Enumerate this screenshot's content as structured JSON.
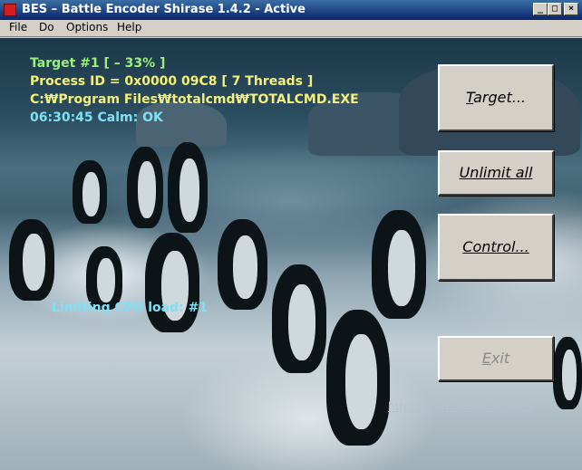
{
  "window": {
    "title": "BES – Battle Encoder Shirase 1.4.2 - Active",
    "controls": {
      "minimize": "_",
      "maximize": "□",
      "close": "×"
    }
  },
  "menu": {
    "file": "File",
    "do": "Do",
    "options": "Options",
    "help": "Help"
  },
  "status": {
    "target": "Target #1 [ – 33% ]",
    "process": "Process ID = 0x0000 09C8 [ 7 Threads ]",
    "path": "C:₩Program Files₩totalcmd₩TOTALCMD.EXE",
    "time": "06:30:45 Calm: OK",
    "limiting": "Limiting CPU load: #1"
  },
  "buttons": {
    "target": {
      "mnemonic": "T",
      "rest": "arget..."
    },
    "unlimit": {
      "mnemonic": "U",
      "rest": "nlimit all"
    },
    "control": {
      "mnemonic": "C",
      "rest": "ontrol..."
    },
    "exit": {
      "mnemonic": "E",
      "rest": "xit"
    }
  },
  "link": "http://mion.faireal.net/BES/",
  "colors": {
    "target": "#98f27a",
    "process": "#f4f07a",
    "path": "#f4f07a",
    "time": "#7fe0f5",
    "limiting": "#7fe0f5"
  }
}
